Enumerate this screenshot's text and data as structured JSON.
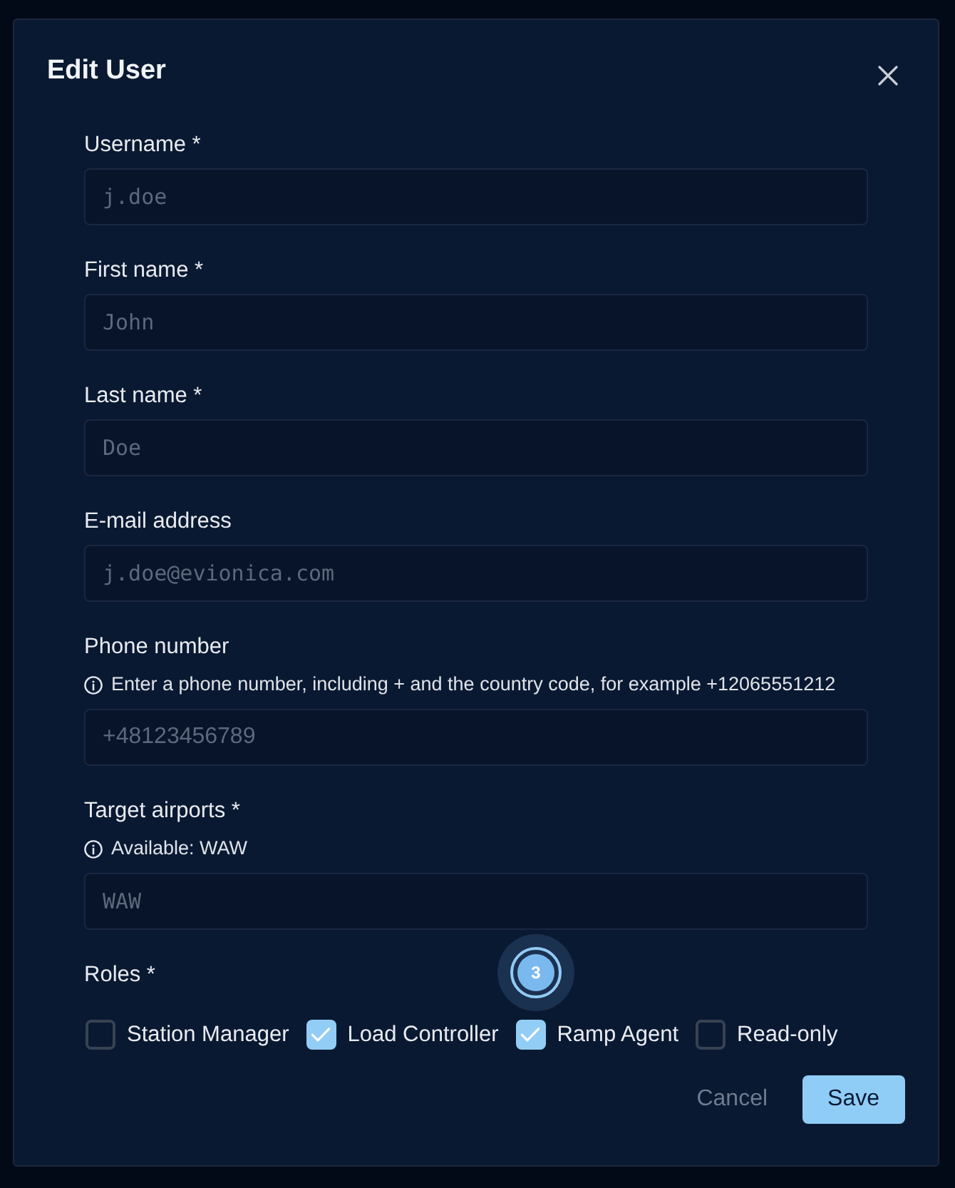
{
  "dialog": {
    "title": "Edit User"
  },
  "fields": [
    {
      "label": "Username *",
      "placeholder": "j.doe",
      "kind": "code"
    },
    {
      "label": "First name *",
      "placeholder": "John",
      "kind": "code"
    },
    {
      "label": "Last name *",
      "placeholder": "Doe",
      "kind": "code"
    },
    {
      "label": "E-mail address",
      "placeholder": "j.doe@evionica.com",
      "kind": "code"
    },
    {
      "label": "Phone number",
      "hint": "Enter a phone number, including + and the country code, for example +12065551212",
      "placeholder": "+48123456789",
      "kind": "phone"
    },
    {
      "label": "Target airports *",
      "hint": "Available: WAW",
      "placeholder": "WAW",
      "kind": "code"
    }
  ],
  "roles": {
    "label": "Roles *",
    "options": [
      {
        "label": "Station Manager",
        "checked": false
      },
      {
        "label": "Load Controller",
        "checked": true
      },
      {
        "label": "Ramp Agent",
        "checked": true
      },
      {
        "label": "Read-only",
        "checked": false
      }
    ]
  },
  "step_marker": {
    "label": "3"
  },
  "buttons": [
    {
      "label": "Cancel",
      "kind": "secondary"
    },
    {
      "label": "Save",
      "kind": "primary"
    }
  ]
}
